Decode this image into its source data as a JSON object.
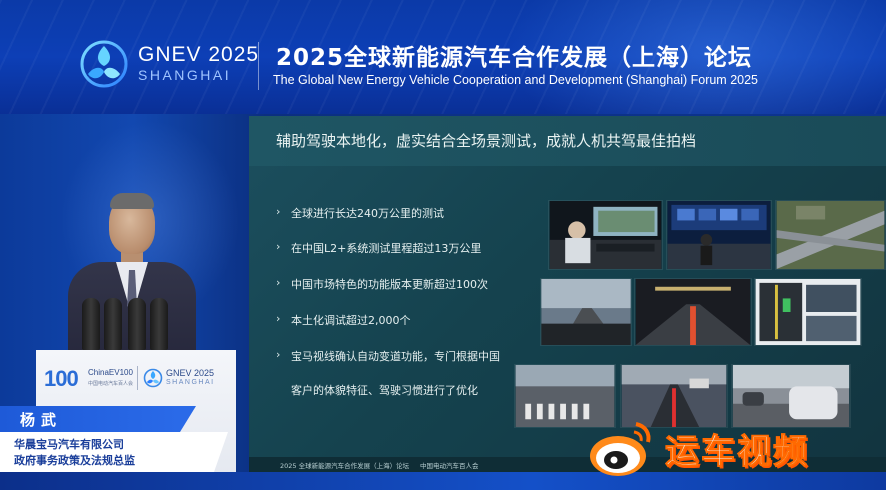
{
  "banner": {
    "logo_line1": "GNEV 2025",
    "logo_line2": "SHANGHAI",
    "title_cn": "2025全球新能源汽车合作发展（上海）论坛",
    "title_en": "The Global New Energy Vehicle  Cooperation and Development (Shanghai) Forum 2025"
  },
  "podium": {
    "logo_100": "100",
    "china_ev": "ChinaEV100",
    "china_ev_sub": "中国电动汽车百人会",
    "gnev": "GNEV 2025",
    "shanghai": "SHANGHAI"
  },
  "speaker": {
    "name": "杨武",
    "title_line1": "华晨宝马汽车有限公司",
    "title_line2": "政府事务政策及法规总监"
  },
  "slide": {
    "title": "辅助驾驶本地化，虚实结合全场景测试，成就人机共驾最佳拍档",
    "bullet_symbol": "›",
    "bullets": [
      "全球进行长达240万公里的测试",
      "在中国L2+系统测试里程超过13万公里",
      "中国市场特色的功能版本更新超过100次",
      "本土化调试超过2,000个",
      "宝马视线确认自动变道功能，专门根据中国",
      "客户的体貌特征、驾驶习惯进行了优化"
    ],
    "footer_left": "2025 全球新能源汽车合作发展（上海）论坛",
    "footer_right": "中国电动汽车百人会"
  },
  "watermark": {
    "text": "运车视频"
  },
  "colors": {
    "banner_blue": "#0d3fb6",
    "slide_teal": "#1c4f5e",
    "name_bar_blue": "#1e5ad8",
    "speaker_title_text": "#1a3e9a",
    "watermark_orange": "#ff6a00"
  }
}
